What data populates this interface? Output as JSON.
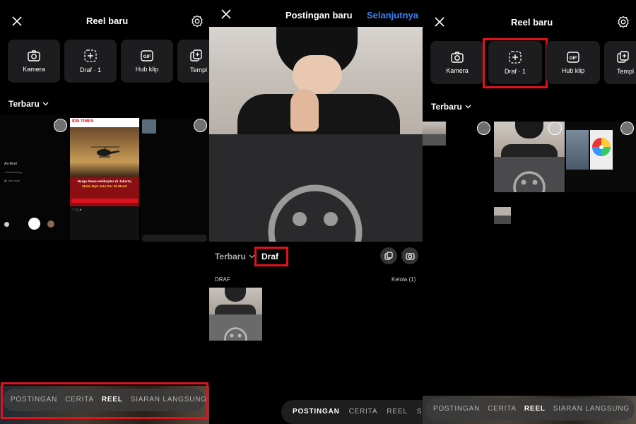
{
  "panel1": {
    "title": "Reel baru",
    "tools": [
      "Kamera",
      "Draf · 1",
      "Hub klip",
      "Templ"
    ],
    "sort_label": "Terbaru",
    "news": {
      "brand": "IDN TIMES",
      "headline": "Harga Sewa Helikopter di Jakarta,",
      "headline2": "Mulai Rp8 Juta Per 10 Menit"
    },
    "modes": [
      "POSTINGAN",
      "CERITA",
      "REEL",
      "SIARAN LANGSUNG"
    ],
    "active_mode": "REEL"
  },
  "panel2": {
    "title": "Postingan baru",
    "next": "Selanjutnya",
    "tab_recent": "Terbaru",
    "tab_draft": "Draf",
    "draft_header": "DRAF",
    "manage": "Kelola (1)",
    "modes": [
      "POSTINGAN",
      "CERITA",
      "REEL",
      "SIAR"
    ],
    "active_mode": "POSTINGAN"
  },
  "panel3": {
    "title": "Reel baru",
    "tools": [
      "Kamera",
      "Draf · 1",
      "Hub klip",
      "Templ"
    ],
    "sort_label": "Terbaru",
    "modes": [
      "POSTINGAN",
      "CERITA",
      "REEL",
      "SIARAN LANGSUNG"
    ],
    "active_mode": "REEL"
  },
  "colors": {
    "highlight": "#e0121e",
    "link": "#3b82f6",
    "tile": "#1d1d1f"
  }
}
